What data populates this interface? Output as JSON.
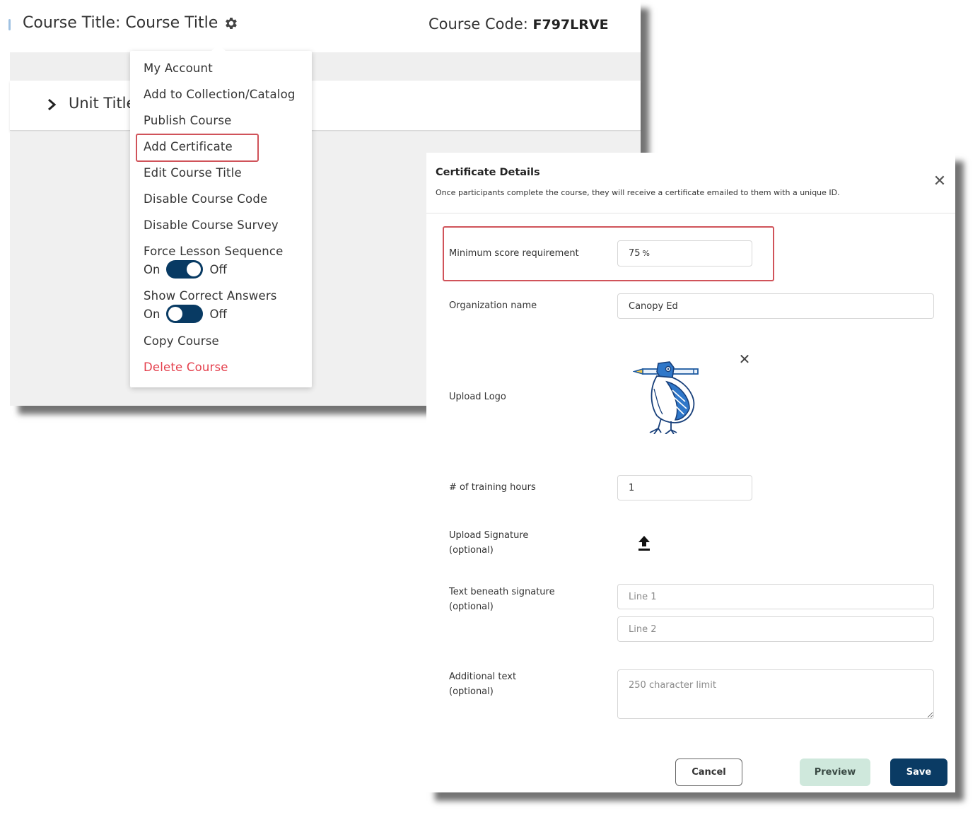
{
  "course": {
    "title": "Course Title: Course Title",
    "code_label": "Course Code: ",
    "code_value": "F797LRVE",
    "unit_title": "Unit Title"
  },
  "menu": {
    "items": [
      {
        "label": "My Account"
      },
      {
        "label": "Add to Collection/Catalog"
      },
      {
        "label": "Publish Course"
      },
      {
        "label": "Add Certificate",
        "highlighted": true
      },
      {
        "label": "Edit Course Title"
      },
      {
        "label": "Disable Course Code"
      },
      {
        "label": "Disable Course Survey"
      },
      {
        "label": "Force Lesson Sequence",
        "toggle": {
          "on_label": "On",
          "off_label": "Off",
          "state": "on"
        }
      },
      {
        "label": "Show Correct Answers",
        "toggle": {
          "on_label": "On",
          "off_label": "Off",
          "state": "off"
        }
      },
      {
        "label": "Copy Course"
      },
      {
        "label": "Delete Course",
        "danger": true
      }
    ]
  },
  "certificate": {
    "title": "Certificate Details",
    "subtitle": "Once participants complete the course, they will receive a certificate emailed to them with a unique ID.",
    "fields": {
      "min_score": {
        "label": "Minimum score requirement",
        "value": "75",
        "suffix": "%"
      },
      "org_name": {
        "label": "Organization name",
        "value": "Canopy Ed"
      },
      "logo": {
        "label": "Upload Logo"
      },
      "training_hours": {
        "label": "# of training hours",
        "value": "1"
      },
      "signature": {
        "label_line1": "Upload Signature",
        "label_line2": "(optional)"
      },
      "sig_text": {
        "label_line1": "Text beneath signature",
        "label_line2": "(optional)",
        "line1_placeholder": "Line 1",
        "line2_placeholder": "Line 2"
      },
      "additional": {
        "label_line1": "Additional text",
        "label_line2": "(optional)",
        "placeholder": "250 character limit"
      }
    },
    "buttons": {
      "cancel": "Cancel",
      "preview": "Preview",
      "save": "Save"
    }
  },
  "colors": {
    "primary": "#0a3b64",
    "danger": "#e4404d",
    "highlight_outline": "#d0535a",
    "preview_bg": "#cfe8dc"
  },
  "icons": {
    "settings": "gear-icon",
    "expand": "chevron-right-icon",
    "close": "close-icon",
    "upload": "upload-icon",
    "logo": "bird-logo"
  }
}
